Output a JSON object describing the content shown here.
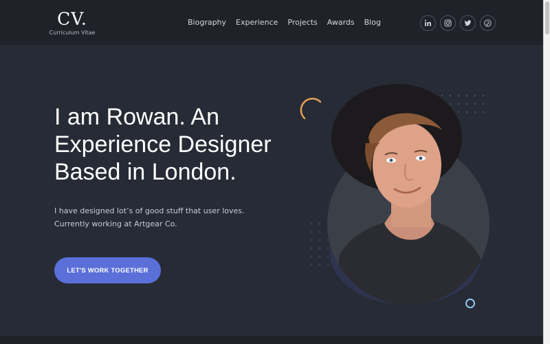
{
  "logo": {
    "mark": "CV.",
    "subtitle": "Curriculum Vitae"
  },
  "nav": [
    {
      "label": "Biography"
    },
    {
      "label": "Experience"
    },
    {
      "label": "Projects"
    },
    {
      "label": "Awards"
    },
    {
      "label": "Blog"
    }
  ],
  "socials": [
    {
      "icon": "linkedin-icon"
    },
    {
      "icon": "instagram-icon"
    },
    {
      "icon": "twitter-icon"
    },
    {
      "icon": "pinterest-icon"
    }
  ],
  "hero": {
    "title_lines": [
      "I am Rowan. An",
      "Experience Designer",
      "Based in London."
    ],
    "desc_lines": [
      "I have designed lot’s of good stuff that user loves.",
      "Currently working at Artgear Co."
    ],
    "cta_label": "LET'S WORK TOGETHER"
  },
  "colors": {
    "background": "#272b36",
    "header": "#1f2229",
    "accent": "#5b6fd9",
    "arc": "#e8a45a",
    "ring": "#8fc8ef"
  }
}
